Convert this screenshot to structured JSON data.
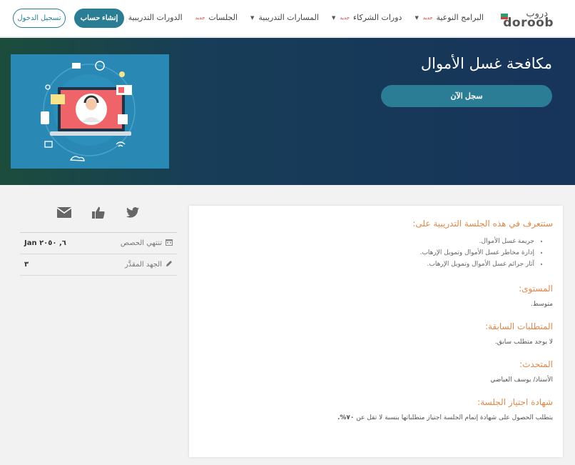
{
  "header": {
    "logo_marks": "دروب",
    "logo_text": "doroob",
    "nav": [
      {
        "label": "الدورات التدريبية",
        "new": "",
        "caret": true
      },
      {
        "label": "الجلسات",
        "new": "جديد",
        "caret": false
      },
      {
        "label": "المسارات التدريبية",
        "new": "",
        "caret": true
      },
      {
        "label": "دورات الشركاء",
        "new": "جديد",
        "caret": true
      },
      {
        "label": "البرامج النوعية",
        "new": "جديد",
        "caret": true
      }
    ],
    "signup_label": "إنشاء حساب",
    "login_label": "تسجيل الدخول"
  },
  "hero": {
    "title": "مكافحة غسل الأموال",
    "register_label": "سجل الآن"
  },
  "sidebar": {
    "share_icons": [
      "twitter-icon",
      "like-icon",
      "mail-icon"
    ],
    "rows": [
      {
        "label": "تنتهي الحصص",
        "value": "Jan ٦, ٢٠٥٠",
        "icon": "calendar-icon"
      },
      {
        "label": "الجهد المقدَّر",
        "value": "٣",
        "icon": "pencil-icon"
      }
    ]
  },
  "content": {
    "learn_title": "ستتعرف في هذه الجلسة التدريبية على:",
    "learn_items": [
      "جريمة غسل الأموال.",
      "إدارة مخاطر غسل الأموال وتمويل الإرهاب.",
      "آثار جرائم غسل الأموال وتمويل الإرهاب."
    ],
    "level_title": "المستوى:",
    "level_value": "متوسط.",
    "prereq_title": "المتطلبات السابقة:",
    "prereq_value": "لا يوجد متطلب سابق.",
    "speaker_title": "المتحدث:",
    "speaker_value": "الأستاذ/ يوسف العياضي",
    "cert_title": "شهادة اجتياز الجلسة:",
    "cert_value": "يتطلب الحصول على شهادة إتمام الجلسة اجتياز متطلباتها بنسبة لا تقل عن ",
    "cert_percent": "٧٠%."
  },
  "colors": {
    "primary": "#2a7d93",
    "accent": "#e0874a",
    "badge": "#e23b3b"
  }
}
